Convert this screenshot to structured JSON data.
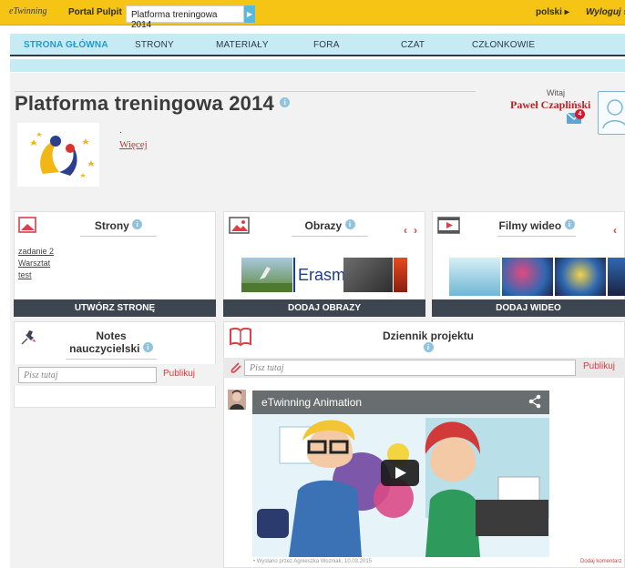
{
  "topbar": {
    "logo": "eTwinning",
    "portal": "Portal",
    "pulpit": "Pulpit",
    "active_tab": "Platforma treningowa 2014",
    "language": "polski",
    "language_arrow": "▸",
    "logout": "Wyloguj si"
  },
  "nav": {
    "items": [
      "STRONA GŁÓWNA",
      "STRONY",
      "MATERIAŁY",
      "FORA",
      "CZAT",
      "CZŁONKOWIE"
    ]
  },
  "header": {
    "title": "Platforma treningowa 2014",
    "dot": ".",
    "more_link": "Więcej",
    "welcome": "Witaj",
    "user_name": "Paweł Czapliński",
    "mail_count": "4"
  },
  "panels": {
    "strony": {
      "title": "Strony",
      "links": [
        "zadanie 2",
        "Warsztat",
        "test"
      ],
      "button": "UTWÓRZ STRONĘ"
    },
    "obrazy": {
      "title": "Obrazy",
      "thumb_text": "Erasm",
      "button": "DODAJ OBRAZY",
      "prev": "‹",
      "next": "›"
    },
    "filmy": {
      "title": "Filmy wideo",
      "button": "DODAJ WIDEO",
      "prev": "‹"
    },
    "notes": {
      "title": "Notes nauczycielski",
      "placeholder": "Pisz tutaj",
      "publish": "Publikuj"
    },
    "dziennik": {
      "title": "Dziennik projektu",
      "placeholder": "Pisz tutaj",
      "publish": "Publikuj",
      "video_title": "eTwinning Animation",
      "posted_by": "• Wysłano przez Agnieszka Wozniak, 10.03.2015",
      "comment_link": "Dodaj komentarz"
    }
  },
  "colors": {
    "topbar": "#f5c415",
    "nav": "#c7ebf4",
    "accent": "#1f9bcf",
    "link_red": "#c0392b",
    "button_dark": "#3d4550"
  }
}
